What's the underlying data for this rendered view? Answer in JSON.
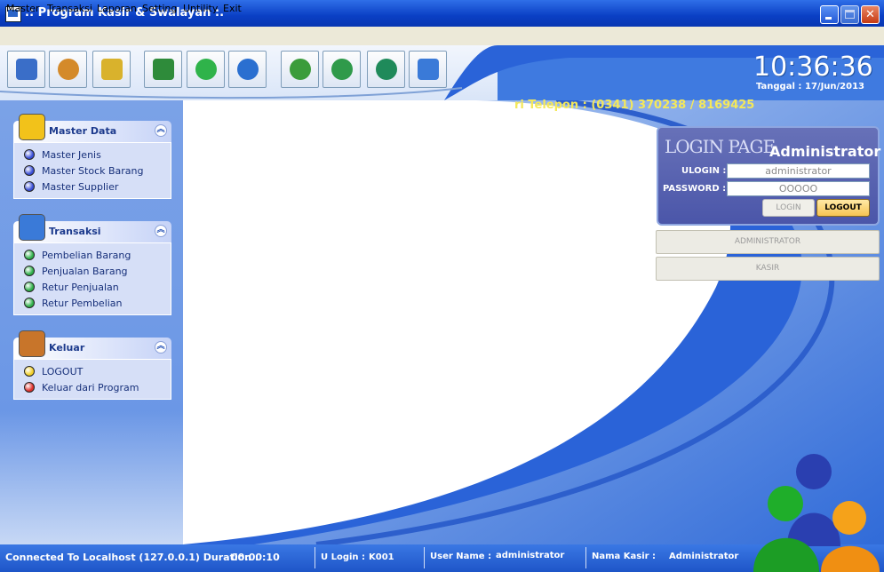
{
  "window": {
    "title": ".: Program Kasir & Swalayan :."
  },
  "menu": {
    "items": [
      "Master",
      "Transaksi",
      "Laporan",
      "Setting",
      "Untility",
      "Exit"
    ]
  },
  "toolbar": {
    "buttons": [
      {
        "icon": "database-icon",
        "color": "#3a6ec8"
      },
      {
        "icon": "user-icon",
        "color": "#d48a2a"
      },
      {
        "icon": "folder-icon",
        "color": "#d9b22c"
      },
      {
        "icon": "money-icon",
        "color": "#2e8b3a"
      },
      {
        "icon": "add-icon",
        "color": "#2fb34a"
      },
      {
        "icon": "refresh-icon",
        "color": "#2a6fd0"
      },
      {
        "icon": "add-user-icon",
        "color": "#3b9c3b"
      },
      {
        "icon": "user-green-icon",
        "color": "#2f9a4a"
      },
      {
        "icon": "cashier-icon",
        "color": "#1f8a5a"
      },
      {
        "icon": "table-icon",
        "color": "#3a7ad8"
      }
    ]
  },
  "clock": {
    "time": "10:36:36",
    "date_label": "Tanggal :",
    "date": "17/Jun/2013"
  },
  "marquee": {
    "text": "ri Telepon : (0341) 370238 / 8169425"
  },
  "sidebar": {
    "panels": [
      {
        "title": "Master Data",
        "icon": "database-icon",
        "items": [
          {
            "label": "Master Jenis",
            "bullet": "#3a4fd8"
          },
          {
            "label": "Master Stock Barang",
            "bullet": "#3a4fd8"
          },
          {
            "label": "Master Supplier",
            "bullet": "#3a4fd8"
          }
        ]
      },
      {
        "title": "Transaksi",
        "icon": "clipboard-icon",
        "items": [
          {
            "label": "Pembelian Barang",
            "bullet": "#2fb04a"
          },
          {
            "label": "Penjualan Barang",
            "bullet": "#2fb04a"
          },
          {
            "label": "Retur Penjualan",
            "bullet": "#2fb04a"
          },
          {
            "label": "Retur Pembelian",
            "bullet": "#2fb04a"
          }
        ]
      },
      {
        "title": "Keluar",
        "icon": "exit-door-icon",
        "items": [
          {
            "label": "LOGOUT",
            "bullet": "#f2d02a"
          },
          {
            "label": "Keluar dari Program",
            "bullet": "#e0302a"
          }
        ]
      }
    ]
  },
  "login": {
    "page_title": "LOGIN PAGE",
    "user_title": "Administrator",
    "ulogin_label": "ULOGIN :",
    "ulogin_value": "administrator",
    "password_label": "PASSWORD :",
    "password_value": "OOOOO",
    "login_button": "LOGIN",
    "logout_button": "LOGOUT",
    "role_buttons": [
      "ADMINISTRATOR",
      "KASIR"
    ]
  },
  "status": {
    "connection": "Connected To Localhost (127.0.0.1) Duration :",
    "duration": "00:00:10",
    "ulogin_label": "U Login :",
    "ulogin_value": "K001",
    "username_label": "User Name :",
    "username_value": "administrator",
    "kasir_label": "Nama Kasir :",
    "kasir_value": "Administrator"
  }
}
